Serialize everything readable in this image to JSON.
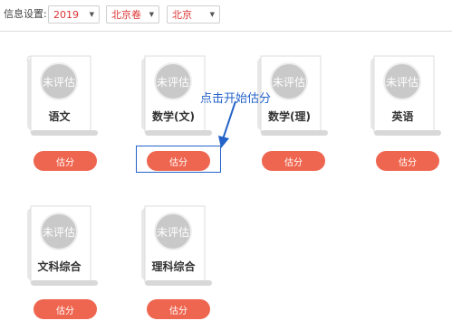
{
  "filters": {
    "label": "信息设置:",
    "year": "2019",
    "exam": "北京卷",
    "region": "北京"
  },
  "annotation": {
    "callout": "点击开始估分"
  },
  "subjects": [
    {
      "name": "语文",
      "status": "未评估",
      "button": "估分"
    },
    {
      "name": "数学(文)",
      "status": "未评估",
      "button": "估分"
    },
    {
      "name": "数学(理)",
      "status": "未评估",
      "button": "估分"
    },
    {
      "name": "英语",
      "status": "未评估",
      "button": "估分"
    },
    {
      "name": "文科综合",
      "status": "未评估",
      "button": "估分"
    },
    {
      "name": "理科综合",
      "status": "未评估",
      "button": "估分"
    }
  ],
  "colors": {
    "accent": "#ef6650",
    "select_text": "#dd3333",
    "annotation": "#2563c9",
    "badge": "#c9c9c9"
  }
}
